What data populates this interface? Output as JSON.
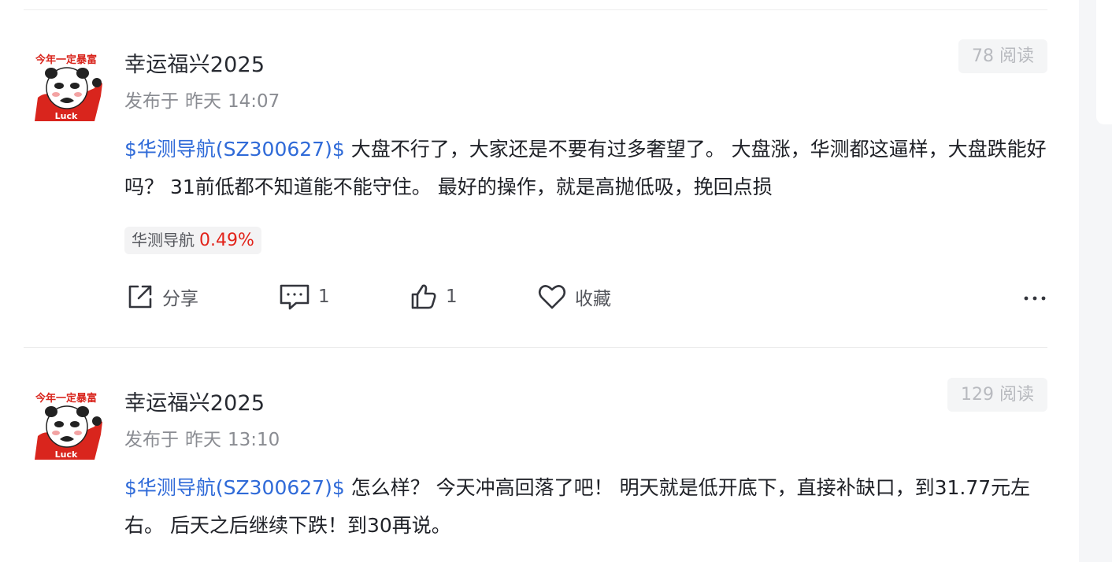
{
  "posts": [
    {
      "author": "幸运福兴2025",
      "avatar": {
        "caption_top": "今年一定暴富",
        "caption_bottom": "Luck"
      },
      "published_prefix": "发布于",
      "published_day": "昨天",
      "published_time": "14:07",
      "reads": "78 阅读",
      "stock_tag": "$华测导航(SZ300627)$",
      "body": " 大盘不行了，大家还是不要有过多奢望了。 大盘涨，华测都这逼样，大盘跌能好吗？ 31前低都不知道能不能守住。 最好的操作，就是高抛低吸，挽回点损",
      "stock_chip": {
        "name": "华测导航",
        "change": "0.49%"
      },
      "actions": {
        "share": "分享",
        "comments": "1",
        "likes": "1",
        "favorite": "收藏"
      }
    },
    {
      "author": "幸运福兴2025",
      "avatar": {
        "caption_top": "今年一定暴富",
        "caption_bottom": "Luck"
      },
      "published_prefix": "发布于",
      "published_day": "昨天",
      "published_time": "13:10",
      "reads": "129 阅读",
      "stock_tag": "$华测导航(SZ300627)$",
      "body": " 怎么样？ 今天冲高回落了吧！ 明天就是低开底下，直接补缺口，到31.77元左右。 后天之后继续下跌！到30再说。"
    }
  ],
  "icons": [
    "share-icon",
    "comment-icon",
    "like-icon",
    "heart-icon",
    "more-icon"
  ],
  "colors": {
    "accent": "#2f6ad8",
    "up_red": "#e2231a",
    "avatar_red": "#d9251d"
  }
}
